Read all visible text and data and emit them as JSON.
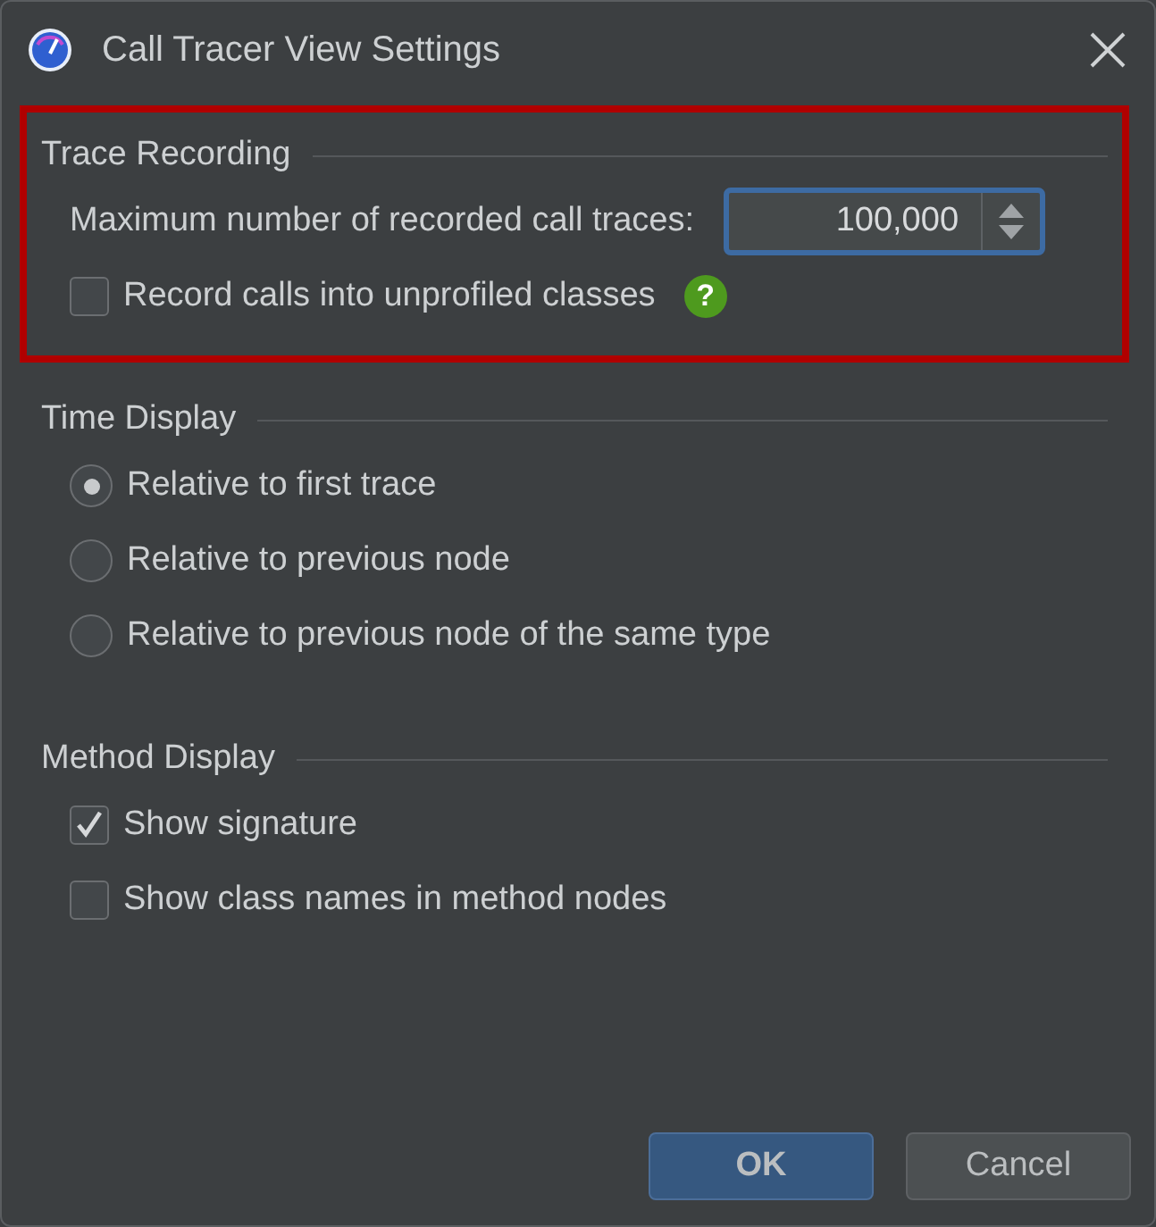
{
  "window": {
    "title": "Call Tracer View Settings"
  },
  "sections": [
    {
      "title": "Trace Recording",
      "highlighted": true,
      "items": [
        {
          "kind": "spinner",
          "label": "Maximum number of recorded call traces:",
          "value": "100,000"
        },
        {
          "kind": "checkbox",
          "label": "Record calls into unprofiled classes",
          "checked": false,
          "help": "?"
        }
      ]
    },
    {
      "title": "Time Display",
      "highlighted": false,
      "items": [
        {
          "kind": "radio",
          "label": "Relative to first trace",
          "selected": true
        },
        {
          "kind": "radio",
          "label": "Relative to previous node",
          "selected": false
        },
        {
          "kind": "radio",
          "label": "Relative to previous node of the same type",
          "selected": false
        }
      ]
    },
    {
      "title": "Method Display",
      "highlighted": false,
      "items": [
        {
          "kind": "checkbox",
          "label": "Show signature",
          "checked": true
        },
        {
          "kind": "checkbox",
          "label": "Show class names in method nodes",
          "checked": false
        }
      ]
    }
  ],
  "buttons": [
    {
      "label": "OK",
      "primary": true
    },
    {
      "label": "Cancel",
      "primary": false
    }
  ]
}
